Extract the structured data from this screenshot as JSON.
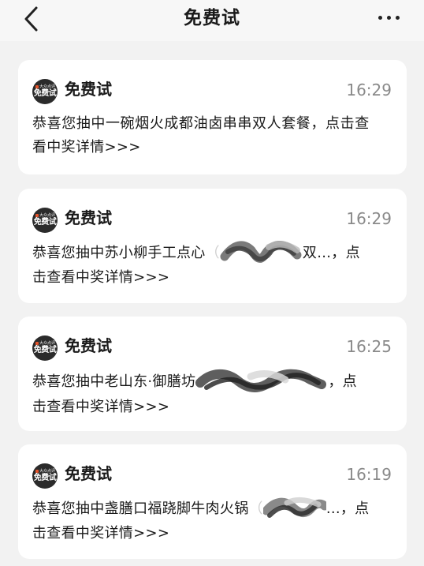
{
  "nav": {
    "title": "免费试"
  },
  "notifications": [
    {
      "avatar_caption": "大众点评",
      "avatar_brand": "免费试",
      "sender": "免费试",
      "time": "16:29",
      "line1": "恭喜您抽中一碗烟火成都油卤串串双人套餐，点击查",
      "line2": "看中奖详情>>>"
    },
    {
      "avatar_caption": "大众点评",
      "avatar_brand": "免费试",
      "sender": "免费试",
      "time": "16:29",
      "line1_before": "恭喜您抽中苏小柳手工点心",
      "line1_redacted_glyph": "（",
      "line1_after": "双...，点",
      "line2": "击查看中奖详情>>>"
    },
    {
      "avatar_caption": "大众点评",
      "avatar_brand": "免费试",
      "sender": "免费试",
      "time": "16:25",
      "line1_before": "恭喜您抽中老山东·御膳坊",
      "line1_after": "，点",
      "line2": "击查看中奖详情>>>"
    },
    {
      "avatar_caption": "大众点评",
      "avatar_brand": "免费试",
      "sender": "免费试",
      "time": "16:19",
      "line1_before": "恭喜您抽中盏膳口福跷脚牛肉火锅",
      "line1_redacted_glyph": "（",
      "line1_after": "...，点",
      "line2": "击查看中奖详情>>>"
    }
  ]
}
